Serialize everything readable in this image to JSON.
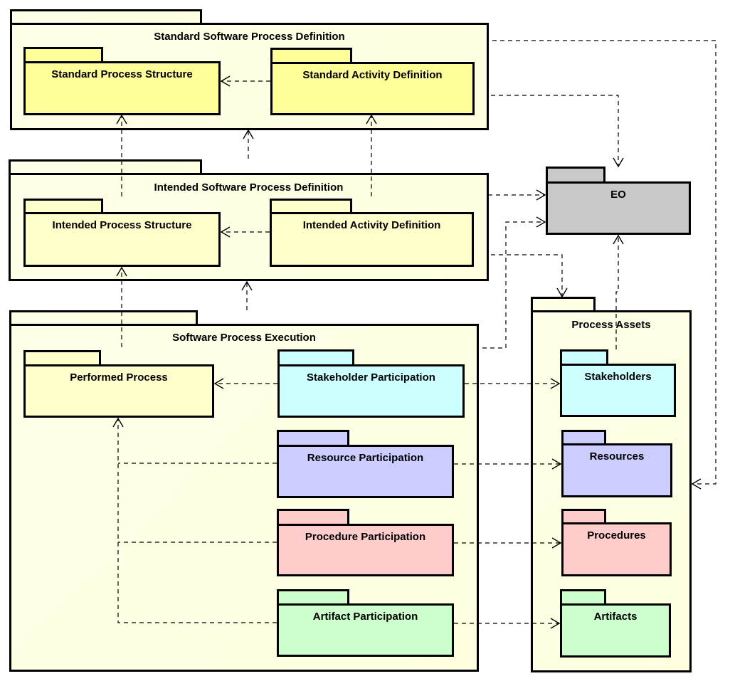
{
  "diagram": {
    "type": "UML package diagram",
    "packages": {
      "standard": {
        "label": "Standard Software Process Definition",
        "children": {
          "structure": "Standard Process Structure",
          "activity": "Standard Activity Definition"
        }
      },
      "intended": {
        "label": "Intended Software Process Definition",
        "children": {
          "structure": "Intended Process Structure",
          "activity": "Intended Activity Definition"
        }
      },
      "execution": {
        "label": "Software Process Execution",
        "children": {
          "performed": "Performed Process",
          "stakeholder": "Stakeholder Participation",
          "resource": "Resource Participation",
          "procedure": "Procedure Participation",
          "artifact": "Artifact Participation"
        }
      },
      "eo": {
        "label": "EO"
      },
      "assets": {
        "label": "Process Assets",
        "children": {
          "stakeholders": "Stakeholders",
          "resources": "Resources",
          "procedures": "Procedures",
          "artifacts": "Artifacts"
        }
      }
    },
    "colors": {
      "outer": "#ffffe6",
      "standard_inner": "#ffff99",
      "intended_inner": "#ffffcc",
      "stakeholder": "#ccffff",
      "resource": "#ccccff",
      "procedure": "#ffcccc",
      "artifact": "#ccffcc",
      "eo": "#c8c8c8"
    },
    "dependencies": [
      {
        "from": "Standard Activity Definition",
        "to": "Standard Process Structure"
      },
      {
        "from": "Standard Software Process Definition",
        "to": "EO"
      },
      {
        "from": "Standard Software Process Definition",
        "to": "Process Assets"
      },
      {
        "from": "Intended Process Structure",
        "to": "Standard Process Structure"
      },
      {
        "from": "Intended Activity Definition",
        "to": "Standard Activity Definition"
      },
      {
        "from": "Intended Software Process Definition",
        "to": "Standard Software Process Definition"
      },
      {
        "from": "Intended Activity Definition",
        "to": "Intended Process Structure"
      },
      {
        "from": "Intended Software Process Definition",
        "to": "EO"
      },
      {
        "from": "Intended Software Process Definition",
        "to": "Process Assets"
      },
      {
        "from": "Performed Process",
        "to": "Intended Process Structure"
      },
      {
        "from": "Software Process Execution",
        "to": "Intended Software Process Definition"
      },
      {
        "from": "Software Process Execution",
        "to": "EO"
      },
      {
        "from": "Stakeholder Participation",
        "to": "Performed Process"
      },
      {
        "from": "Resource Participation",
        "to": "Performed Process"
      },
      {
        "from": "Procedure Participation",
        "to": "Performed Process"
      },
      {
        "from": "Artifact Participation",
        "to": "Performed Process"
      },
      {
        "from": "Stakeholder Participation",
        "to": "Stakeholders"
      },
      {
        "from": "Resource Participation",
        "to": "Resources"
      },
      {
        "from": "Procedure Participation",
        "to": "Procedures"
      },
      {
        "from": "Artifact Participation",
        "to": "Artifacts"
      },
      {
        "from": "Stakeholders",
        "to": "EO"
      }
    ]
  }
}
